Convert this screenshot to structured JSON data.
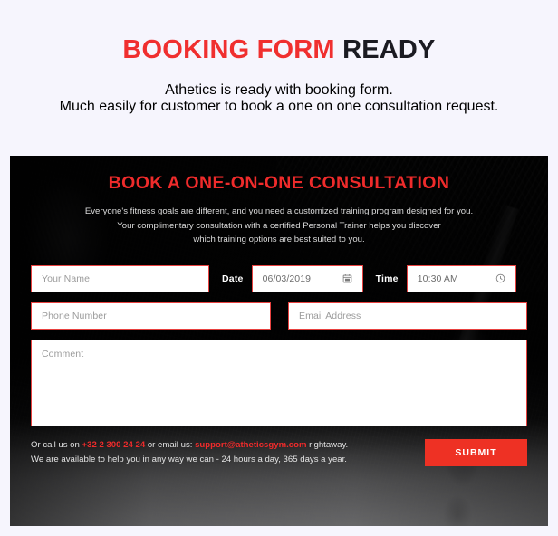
{
  "theme": {
    "page_bg": "#f6f5fd",
    "accent_red": "#f02f2f",
    "field_border": "#e8413f",
    "submit_bg": "#ee3124",
    "panel_bg": "#080809"
  },
  "section": {
    "title_accent": "BOOKING FORM",
    "title_rest": "READY",
    "subtitle_line1": "Athetics is ready with booking form.",
    "subtitle_line2": "Much easily for customer to book a one on one consultation request."
  },
  "booking": {
    "heading": "BOOK A ONE-ON-ONE CONSULTATION",
    "description_line1": "Everyone's fitness goals are different, and you need a customized training program designed for you.",
    "description_line2": "Your complimentary consultation with a certified Personal Trainer helps you discover",
    "description_line3": "which training options are best suited to you.",
    "fields": {
      "name_placeholder": "Your Name",
      "date_label": "Date",
      "date_value": "06/03/2019",
      "date_icon": "calendar-icon",
      "time_label": "Time",
      "time_value": "10:30 AM",
      "time_icon": "clock-icon",
      "phone_placeholder": "Phone Number",
      "email_placeholder": "Email Address",
      "comment_placeholder": "Comment"
    },
    "footer": {
      "line1_pre": "Or call us on ",
      "phone": "+32 2 300 24 24",
      "line1_mid": " or email us: ",
      "email": "support@atheticsgym.com",
      "line1_post": " rightaway.",
      "line2": "We are available to help you in any way we can - 24 hours a day, 365 days a year."
    },
    "submit_label": "SUBMIT"
  }
}
